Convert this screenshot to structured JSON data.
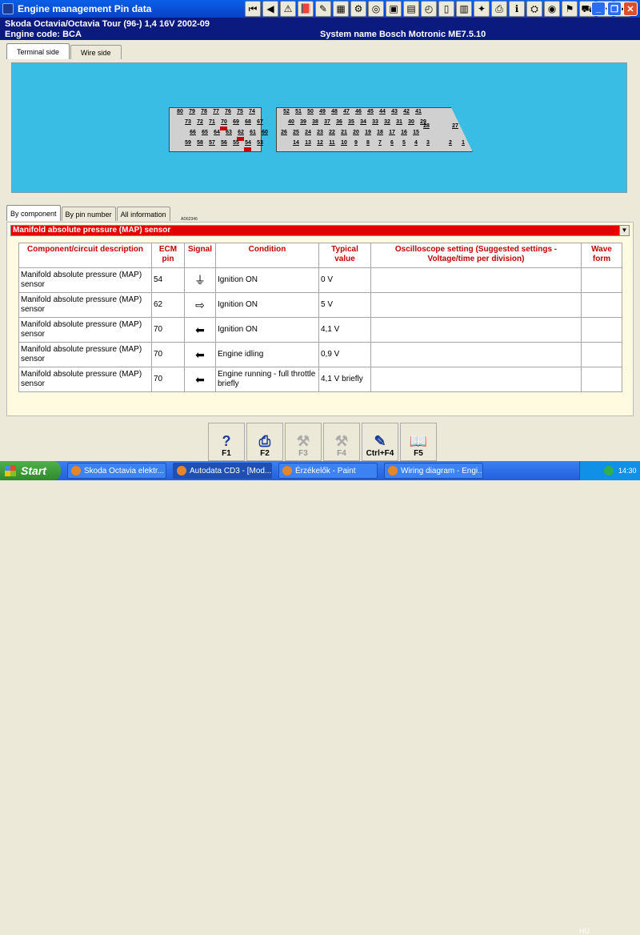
{
  "window": {
    "title": "Engine management Pin data"
  },
  "toolbar": {
    "icons": [
      "first-icon",
      "prev-icon",
      "warning-icon",
      "book-icon",
      "pen-icon",
      "map-icon",
      "tool-icon",
      "disc-icon",
      "camera-icon",
      "chart-icon",
      "timing-icon",
      "door-icon",
      "folder-icon",
      "bulb-icon",
      "print-icon",
      "info-icon",
      "engine-icon",
      "wheel-icon",
      "flag-icon",
      "car-icon",
      "gauge-icon",
      "spanner-icon"
    ]
  },
  "vehicle": {
    "make_model": "Skoda   Octavia/Octavia Tour (96-) 1,4 16V 2002-09",
    "engine_code": "Engine code: BCA",
    "system_name": "System name Bosch Motronic ME7.5.10"
  },
  "top_tabs": [
    "Terminal side",
    "Wire side"
  ],
  "diagram": {
    "label": "AD62346",
    "left_connector": {
      "rows": [
        [
          "80",
          "79",
          "78",
          "77",
          "76",
          "75",
          "74"
        ],
        [
          "73",
          "72",
          "71",
          "70",
          "69",
          "68",
          "67"
        ],
        [
          "66",
          "65",
          "64",
          "63",
          "62",
          "61",
          "60"
        ],
        [
          "59",
          "58",
          "57",
          "56",
          "55",
          "54",
          "53"
        ]
      ],
      "highlighted": [
        "70",
        "62",
        "54"
      ]
    },
    "right_connector": {
      "rows": [
        [
          "52",
          "51",
          "50",
          "49",
          "48",
          "47",
          "46",
          "45",
          "44",
          "43",
          "42",
          "41"
        ],
        [
          "40",
          "39",
          "38",
          "37",
          "36",
          "35",
          "34",
          "33",
          "32",
          "31",
          "30",
          "29"
        ],
        [
          "26",
          "25",
          "24",
          "23",
          "22",
          "21",
          "20",
          "19",
          "18",
          "17",
          "16",
          "15"
        ],
        [
          "14",
          "13",
          "12",
          "11",
          "10",
          "9",
          "8",
          "7",
          "6",
          "5",
          "4",
          "3"
        ]
      ],
      "side": [
        "28",
        "27",
        "2",
        "1"
      ]
    }
  },
  "info_tabs": [
    "By component",
    "By pin number",
    "All information"
  ],
  "component": {
    "selected": "Manifold absolute pressure (MAP) sensor"
  },
  "table": {
    "headers": [
      "Component/circuit description",
      "ECM pin",
      "Signal",
      "Condition",
      "Typical value",
      "Oscilloscope setting (Suggested settings - Voltage/time per division)",
      "Wave form"
    ],
    "rows": [
      {
        "desc": "Manifold absolute pressure (MAP) sensor",
        "pin": "54",
        "signal": "ground-icon",
        "signal_glyph": "⏚",
        "condition": "Ignition ON",
        "value": "0 V",
        "osc": "",
        "wave": ""
      },
      {
        "desc": "Manifold absolute pressure (MAP) sensor",
        "pin": "62",
        "signal": "output-arrow-icon",
        "signal_glyph": "⇨",
        "condition": "Ignition ON",
        "value": "5 V",
        "osc": "",
        "wave": ""
      },
      {
        "desc": "Manifold absolute pressure (MAP) sensor",
        "pin": "70",
        "signal": "input-arrow-icon",
        "signal_glyph": "⬅",
        "condition": "Ignition ON",
        "value": "4,1 V",
        "osc": "",
        "wave": ""
      },
      {
        "desc": "Manifold absolute pressure (MAP) sensor",
        "pin": "70",
        "signal": "input-arrow-icon",
        "signal_glyph": "⬅",
        "condition": "Engine idling",
        "value": "0,9 V",
        "osc": "",
        "wave": ""
      },
      {
        "desc": "Manifold absolute pressure (MAP) sensor",
        "pin": "70",
        "signal": "input-arrow-icon",
        "signal_glyph": "⬅",
        "condition": "Engine running - full throttle briefly",
        "value": "4,1 V briefly",
        "osc": "",
        "wave": ""
      }
    ]
  },
  "fkeys": [
    {
      "label": "F1",
      "icon": "help-icon",
      "glyph": "?",
      "enabled": true
    },
    {
      "label": "F2",
      "icon": "printer-icon",
      "glyph": "⎙",
      "enabled": true
    },
    {
      "label": "F3",
      "icon": "tools-icon",
      "glyph": "⚒",
      "enabled": false
    },
    {
      "label": "F4",
      "icon": "tools-icon",
      "glyph": "⚒",
      "enabled": false
    },
    {
      "label": "Ctrl+F4",
      "icon": "notes-icon",
      "glyph": "✎",
      "enabled": true
    },
    {
      "label": "F5",
      "icon": "book-icon",
      "glyph": "📖",
      "enabled": true
    }
  ],
  "taskbar": {
    "start": "Start",
    "tasks": [
      "Skoda Octavia elektr...",
      "Autodata CD3 - [Mod...",
      "Érzékelők - Paint",
      "Wiring diagram - Engi..."
    ],
    "lang": "HU",
    "clock": "14:30"
  }
}
